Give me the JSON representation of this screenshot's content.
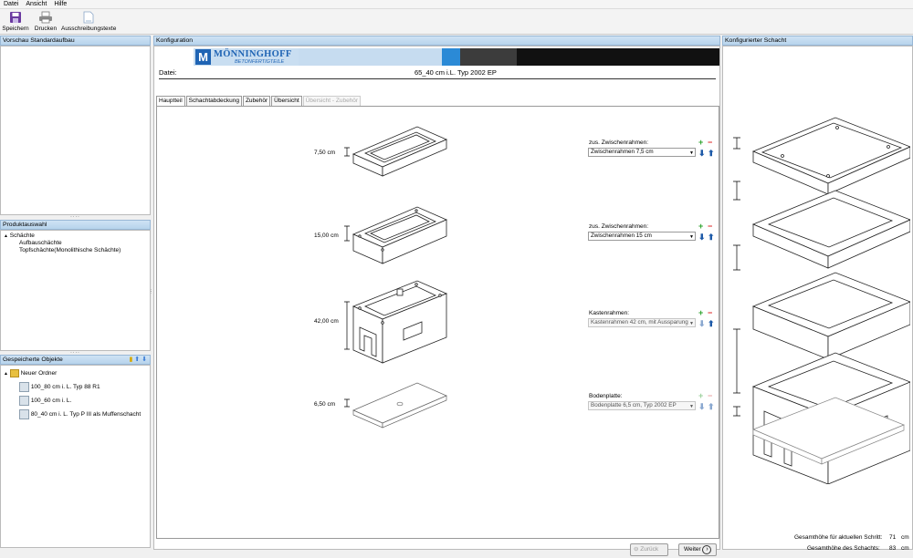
{
  "menu": [
    "Datei",
    "Ansicht",
    "Hilfe"
  ],
  "toolbar": {
    "save": "Speichern",
    "print": "Drucken",
    "texts": "Ausschreibungstexte"
  },
  "left": {
    "preview_title": "Vorschau Standardaufbau",
    "product_title": "Produktauswahl",
    "tree": {
      "root": "Schächte",
      "child1": "Aufbauschächte",
      "child2": "Topfschächte(Monolithische Schächte)"
    },
    "saved_title": "Gespeicherte Objekte",
    "folder": "Neuer Ordner",
    "items": [
      "100_80 cm i. L. Typ 88 R1",
      "100_60 cm i. L.",
      "80_40 cm i. L. Typ P III als Muffenschacht"
    ]
  },
  "config": {
    "title": "Konfiguration",
    "brand": "MÖNNINGHOFF",
    "brand_sub": "BETONFERTIGTEILE",
    "file_label": "Datei:",
    "file_name": "65_40 cm i.L. Typ 2002 EP",
    "tabs": [
      "Hauptteil",
      "Schachtabdeckung",
      "Zubehör",
      "Übersicht",
      "Übersicht - Zubehör"
    ],
    "parts": [
      {
        "dim": "7,50",
        "unit": "cm",
        "label": "zus. Zwischenrahmen:",
        "value": "Zwischenrahmen 7,5 cm"
      },
      {
        "dim": "15,00",
        "unit": "cm",
        "label": "zus. Zwischenrahmen:",
        "value": "Zwischenrahmen 15 cm"
      },
      {
        "dim": "42,00",
        "unit": "cm",
        "label": "Kastenrahmen:",
        "value": "Kastenrahmen 42 cm, mit Aussparung"
      },
      {
        "dim": "6,50",
        "unit": "cm",
        "label": "Bodenplatte:",
        "value": "Bodenplatte 6,5 cm, Typ 2002 EP"
      }
    ],
    "back": "Zurück",
    "next": "Weiter"
  },
  "right": {
    "title": "Konfigurierter Schacht",
    "total_step_label": "Gesamthöhe für aktuellen Schritt:",
    "total_step_value": "71",
    "total_label": "Gesamthöhe des Schachts:",
    "total_value": "83",
    "unit": "cm"
  },
  "colors": {
    "header_bg": "#c6dcf0",
    "brand_blue": "#1f64b4",
    "dark": "#111111"
  }
}
